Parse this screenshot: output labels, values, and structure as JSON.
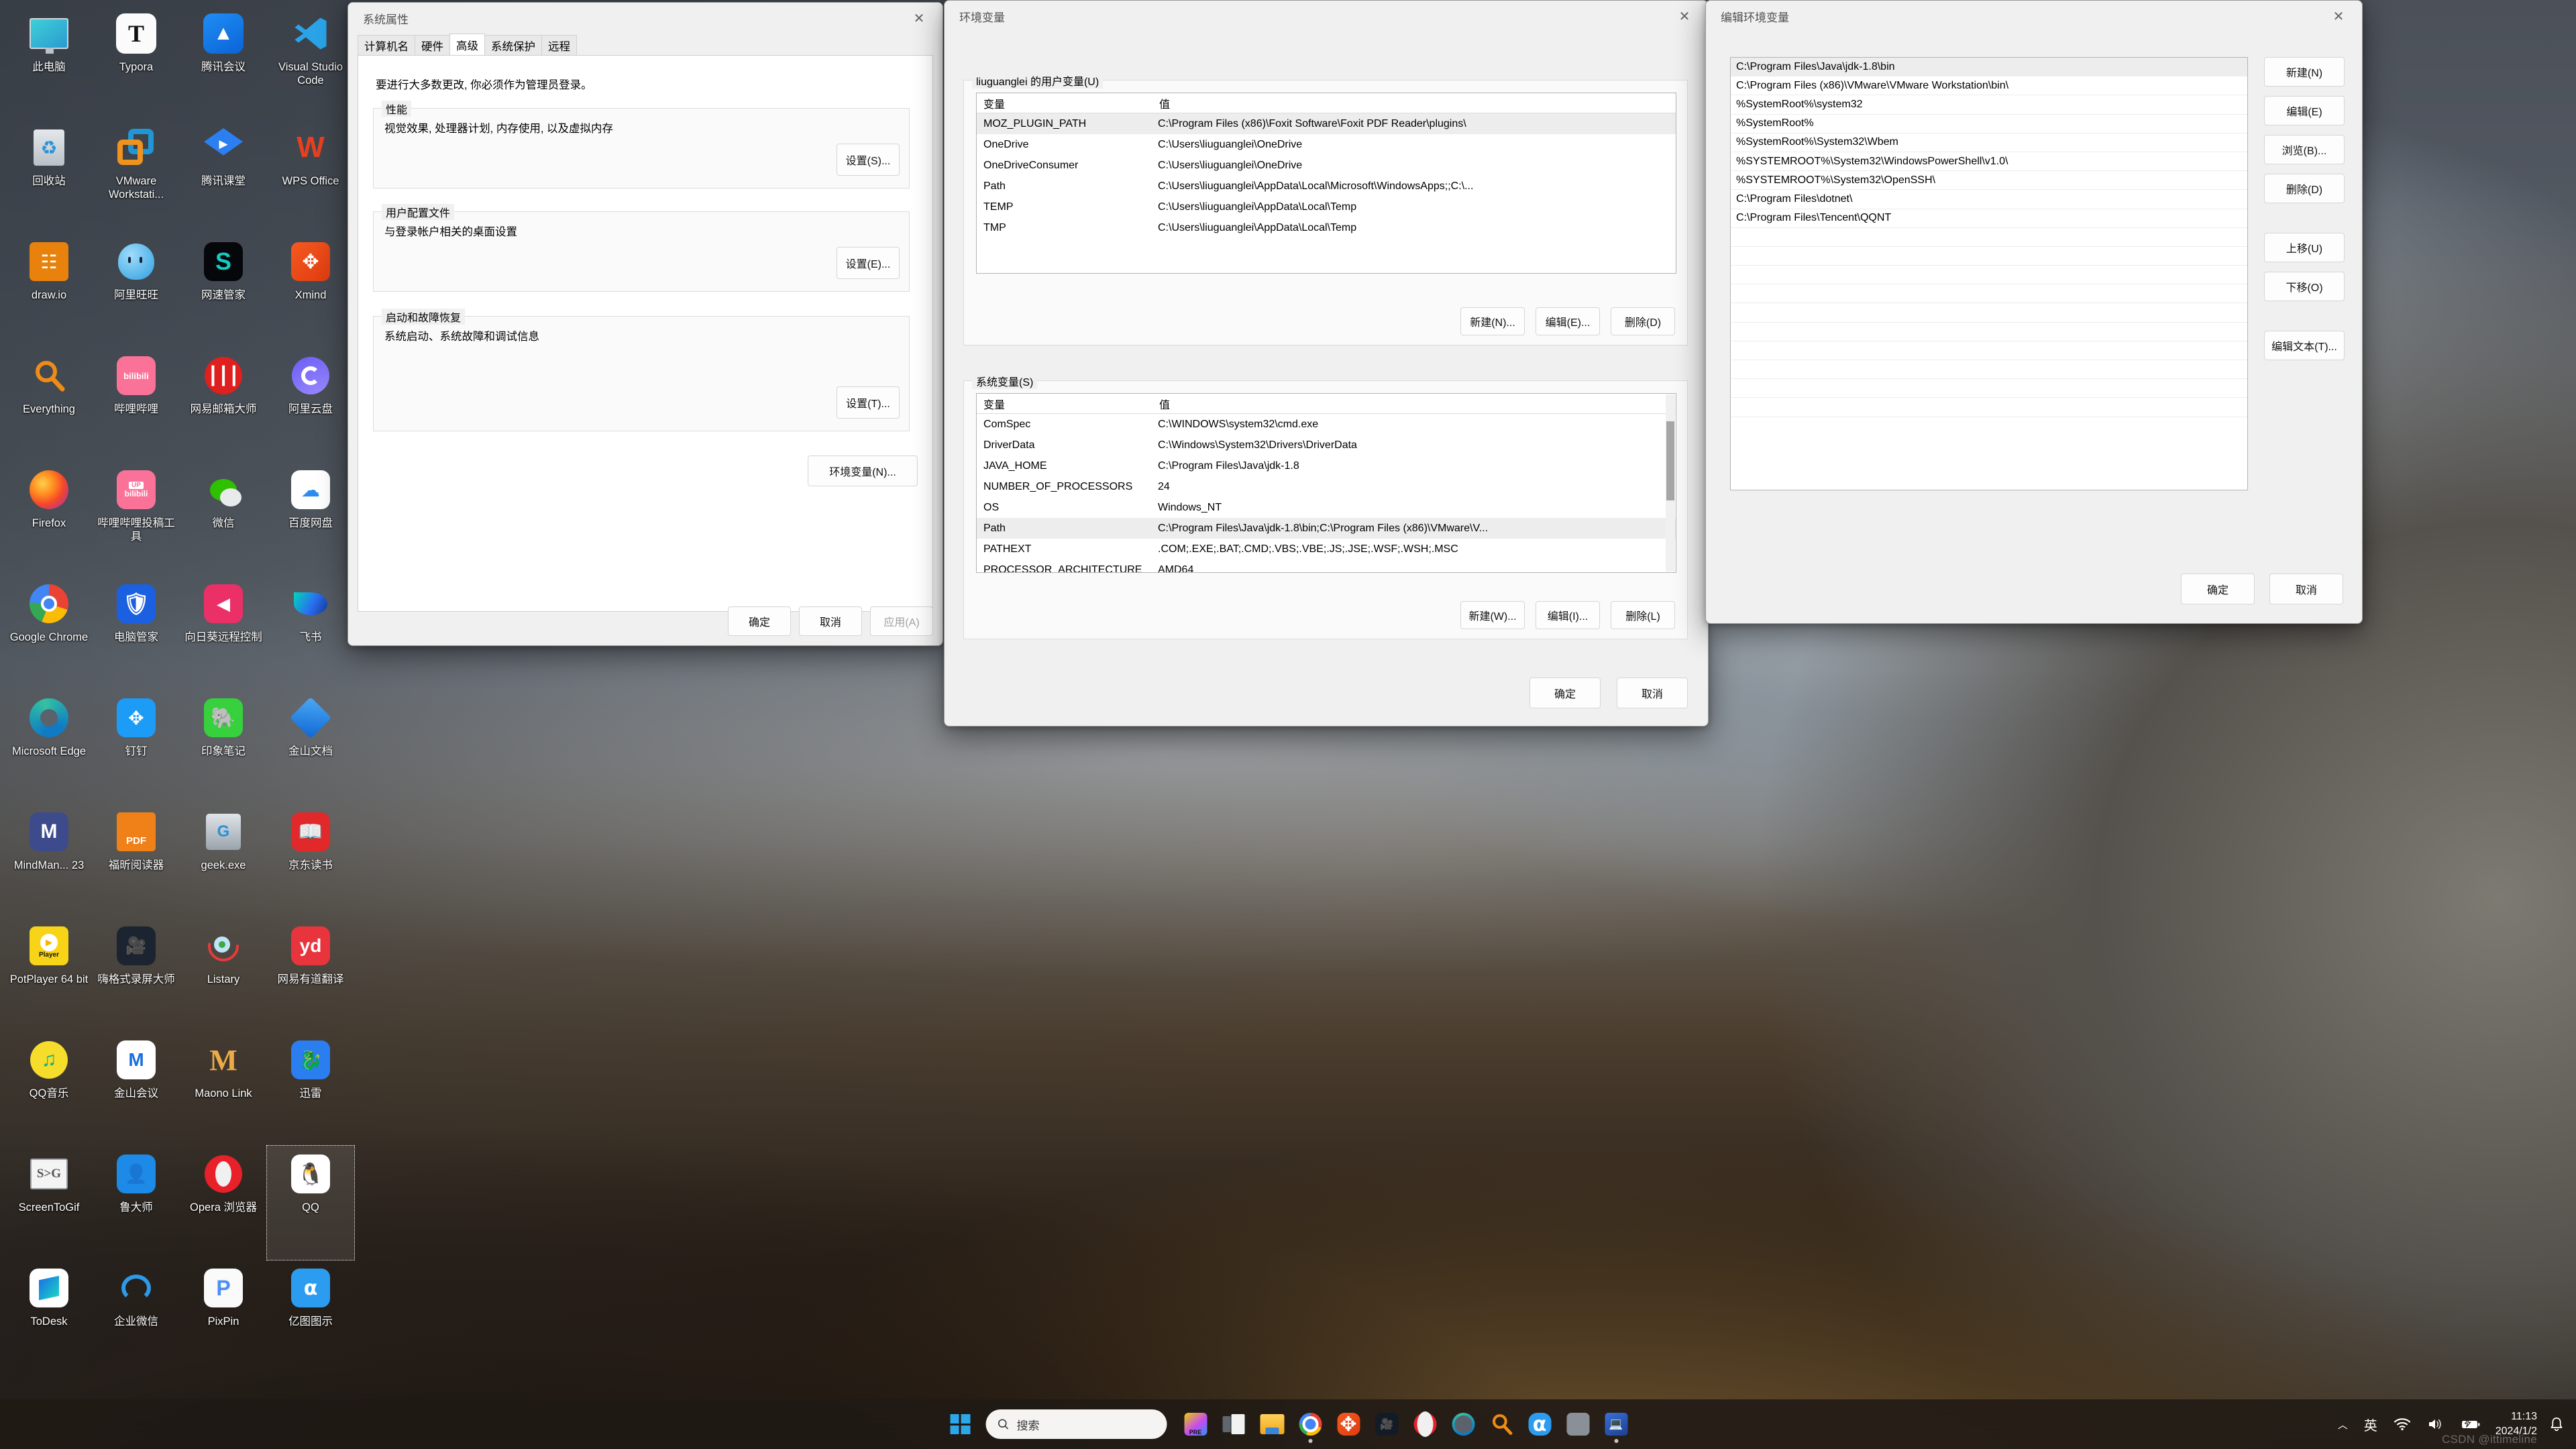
{
  "desktop": {
    "icons": [
      {
        "label": "此电脑",
        "icon": "this-pc-icon"
      },
      {
        "label": "Typora",
        "icon": "typora-icon"
      },
      {
        "label": "腾讯会议",
        "icon": "tencent-meeting-icon"
      },
      {
        "label": "Visual Studio Code",
        "icon": "vscode-icon"
      },
      {
        "label": "回收站",
        "icon": "recycle-bin-icon"
      },
      {
        "label": "VMware Workstati...",
        "icon": "vmware-workstation-icon"
      },
      {
        "label": "腾讯课堂",
        "icon": "tencent-ketang-icon"
      },
      {
        "label": "WPS Office",
        "icon": "wps-office-icon"
      },
      {
        "label": "draw.io",
        "icon": "drawio-icon"
      },
      {
        "label": "阿里旺旺",
        "icon": "aliwangwang-icon"
      },
      {
        "label": "网速管家",
        "icon": "wangsu-guanjia-icon"
      },
      {
        "label": "Xmind",
        "icon": "xmind-icon"
      },
      {
        "label": "Everything",
        "icon": "everything-icon"
      },
      {
        "label": "哔哩哔哩",
        "icon": "bilibili-icon"
      },
      {
        "label": "网易邮箱大师",
        "icon": "netease-mail-icon"
      },
      {
        "label": "阿里云盘",
        "icon": "aliyun-drive-icon"
      },
      {
        "label": "Firefox",
        "icon": "firefox-icon"
      },
      {
        "label": "哔哩哔哩投稿工具",
        "icon": "bilibili-upload-icon"
      },
      {
        "label": "微信",
        "icon": "wechat-icon"
      },
      {
        "label": "百度网盘",
        "icon": "baidu-netdisk-icon"
      },
      {
        "label": "Google Chrome",
        "icon": "chrome-icon"
      },
      {
        "label": "电脑管家",
        "icon": "tencent-pcmgr-icon"
      },
      {
        "label": "向日葵远程控制",
        "icon": "sunlogin-icon"
      },
      {
        "label": "飞书",
        "icon": "feishu-icon"
      },
      {
        "label": "Microsoft Edge",
        "icon": "edge-icon"
      },
      {
        "label": "钉钉",
        "icon": "dingtalk-icon"
      },
      {
        "label": "印象笔记",
        "icon": "evernote-icon"
      },
      {
        "label": "金山文档",
        "icon": "kingsoft-docs-icon"
      },
      {
        "label": "MindMan... 23",
        "icon": "mindmanager-icon"
      },
      {
        "label": "福昕阅读器",
        "icon": "foxit-reader-icon"
      },
      {
        "label": "geek.exe",
        "icon": "geek-uninstaller-icon"
      },
      {
        "label": "京东读书",
        "icon": "jd-read-icon"
      },
      {
        "label": "PotPlayer 64 bit",
        "icon": "potplayer-icon"
      },
      {
        "label": "嗨格式录屏大师",
        "icon": "higeshi-recorder-icon"
      },
      {
        "label": "Listary",
        "icon": "listary-icon"
      },
      {
        "label": "网易有道翻译",
        "icon": "youdao-translate-icon"
      },
      {
        "label": "QQ音乐",
        "icon": "qq-music-icon"
      },
      {
        "label": "金山会议",
        "icon": "kingsoft-meeting-icon"
      },
      {
        "label": "Maono Link",
        "icon": "maono-link-icon"
      },
      {
        "label": "迅雷",
        "icon": "thunder-icon"
      },
      {
        "label": "ScreenToGif",
        "icon": "screentogif-icon"
      },
      {
        "label": "鲁大师",
        "icon": "ludashi-icon"
      },
      {
        "label": "Opera 浏览器",
        "icon": "opera-icon"
      },
      {
        "label": "QQ",
        "icon": "qq-icon",
        "selected": true
      },
      {
        "label": "ToDesk",
        "icon": "todesk-icon"
      },
      {
        "label": "企业微信",
        "icon": "wecom-icon"
      },
      {
        "label": "PixPin",
        "icon": "pixpin-icon"
      },
      {
        "label": "亿图图示",
        "icon": "edraw-icon"
      }
    ]
  },
  "system_properties": {
    "title": "系统属性",
    "close_label": "✕",
    "tabs": [
      {
        "label": "计算机名",
        "active": false
      },
      {
        "label": "硬件",
        "active": false
      },
      {
        "label": "高级",
        "active": true
      },
      {
        "label": "系统保护",
        "active": false
      },
      {
        "label": "远程",
        "active": false
      }
    ],
    "admin_notice": "要进行大多数更改, 你必须作为管理员登录。",
    "groups": [
      {
        "legend": "性能",
        "text": "视觉效果, 处理器计划, 内存使用, 以及虚拟内存",
        "button": "设置(S)..."
      },
      {
        "legend": "用户配置文件",
        "text": "与登录帐户相关的桌面设置",
        "button": "设置(E)..."
      },
      {
        "legend": "启动和故障恢复",
        "text": "系统启动、系统故障和调试信息",
        "button": "设置(T)..."
      }
    ],
    "env_button": "环境变量(N)...",
    "ok_label": "确定",
    "cancel_label": "取消",
    "apply_label": "应用(A)"
  },
  "environment_variables": {
    "title": "环境变量",
    "close_label": "✕",
    "user_section": {
      "legend": "liuguanglei 的用户变量(U)",
      "columns": [
        "变量",
        "值"
      ],
      "rows": [
        {
          "name": "MOZ_PLUGIN_PATH",
          "value": "C:\\Program Files (x86)\\Foxit Software\\Foxit PDF Reader\\plugins\\",
          "selected": true
        },
        {
          "name": "OneDrive",
          "value": "C:\\Users\\liuguanglei\\OneDrive"
        },
        {
          "name": "OneDriveConsumer",
          "value": "C:\\Users\\liuguanglei\\OneDrive"
        },
        {
          "name": "Path",
          "value": "C:\\Users\\liuguanglei\\AppData\\Local\\Microsoft\\WindowsApps;;C:\\..."
        },
        {
          "name": "TEMP",
          "value": "C:\\Users\\liuguanglei\\AppData\\Local\\Temp"
        },
        {
          "name": "TMP",
          "value": "C:\\Users\\liuguanglei\\AppData\\Local\\Temp"
        }
      ],
      "new_label": "新建(N)...",
      "edit_label": "编辑(E)...",
      "delete_label": "删除(D)"
    },
    "system_section": {
      "legend": "系统变量(S)",
      "columns": [
        "变量",
        "值"
      ],
      "rows": [
        {
          "name": "ComSpec",
          "value": "C:\\WINDOWS\\system32\\cmd.exe"
        },
        {
          "name": "DriverData",
          "value": "C:\\Windows\\System32\\Drivers\\DriverData"
        },
        {
          "name": "JAVA_HOME",
          "value": "C:\\Program Files\\Java\\jdk-1.8"
        },
        {
          "name": "NUMBER_OF_PROCESSORS",
          "value": "24"
        },
        {
          "name": "OS",
          "value": "Windows_NT"
        },
        {
          "name": "Path",
          "value": "C:\\Program Files\\Java\\jdk-1.8\\bin;C:\\Program Files (x86)\\VMware\\V...",
          "selected": true
        },
        {
          "name": "PATHEXT",
          "value": ".COM;.EXE;.BAT;.CMD;.VBS;.VBE;.JS;.JSE;.WSF;.WSH;.MSC"
        },
        {
          "name": "PROCESSOR_ARCHITECTURE",
          "value": "AMD64"
        }
      ],
      "new_label": "新建(W)...",
      "edit_label": "编辑(I)...",
      "delete_label": "删除(L)"
    },
    "ok_label": "确定",
    "cancel_label": "取消"
  },
  "edit_environment_variable": {
    "title": "编辑环境变量",
    "close_label": "✕",
    "entries": [
      {
        "value": "C:\\Program Files\\Java\\jdk-1.8\\bin",
        "selected": true
      },
      {
        "value": "C:\\Program Files (x86)\\VMware\\VMware Workstation\\bin\\"
      },
      {
        "value": "%SystemRoot%\\system32"
      },
      {
        "value": "%SystemRoot%"
      },
      {
        "value": "%SystemRoot%\\System32\\Wbem"
      },
      {
        "value": "%SYSTEMROOT%\\System32\\WindowsPowerShell\\v1.0\\"
      },
      {
        "value": "%SYSTEMROOT%\\System32\\OpenSSH\\"
      },
      {
        "value": "C:\\Program Files\\dotnet\\"
      },
      {
        "value": "C:\\Program Files\\Tencent\\QQNT"
      },
      {
        "value": ""
      },
      {
        "value": ""
      },
      {
        "value": ""
      },
      {
        "value": ""
      },
      {
        "value": ""
      },
      {
        "value": ""
      },
      {
        "value": ""
      },
      {
        "value": ""
      },
      {
        "value": ""
      },
      {
        "value": ""
      }
    ],
    "buttons": [
      {
        "label": "新建(N)",
        "name": "new-button"
      },
      {
        "label": "编辑(E)",
        "name": "edit-button"
      },
      {
        "label": "浏览(B)...",
        "name": "browse-button"
      },
      {
        "label": "删除(D)",
        "name": "delete-button"
      },
      {
        "label": "上移(U)",
        "name": "move-up-button"
      },
      {
        "label": "下移(O)",
        "name": "move-down-button"
      },
      {
        "label": "编辑文本(T)...",
        "name": "edit-text-button"
      }
    ],
    "ok_label": "确定",
    "cancel_label": "取消"
  },
  "taskbar": {
    "start_label": "开始",
    "search": {
      "placeholder": "搜索",
      "icon": "search-icon"
    },
    "items": [
      {
        "name": "taskbar-premiere",
        "icon": "premiere-icon",
        "running": false
      },
      {
        "name": "taskbar-task-view",
        "icon": "task-view-icon",
        "running": false
      },
      {
        "name": "taskbar-file-explorer",
        "icon": "file-explorer-icon",
        "running": false
      },
      {
        "name": "taskbar-chrome",
        "icon": "chrome-icon",
        "running": true
      },
      {
        "name": "taskbar-xmind",
        "icon": "xmind-icon",
        "running": false
      },
      {
        "name": "taskbar-recorder",
        "icon": "recorder-icon",
        "running": false
      },
      {
        "name": "taskbar-opera",
        "icon": "opera-icon",
        "running": false
      },
      {
        "name": "taskbar-edge",
        "icon": "edge-icon",
        "running": false
      },
      {
        "name": "taskbar-everything",
        "icon": "everything-icon",
        "running": false
      },
      {
        "name": "taskbar-edraw",
        "icon": "edraw-icon",
        "running": false
      },
      {
        "name": "taskbar-youdao",
        "icon": "youdao-icon",
        "running": false
      },
      {
        "name": "taskbar-system-properties",
        "icon": "system-properties-icon",
        "running": true
      }
    ],
    "tray": {
      "chevron": "︿",
      "ime": "英",
      "wifi_icon": "wifi-icon",
      "volume_icon": "volume-icon",
      "battery_icon": "battery-charging-icon",
      "time": "11:13",
      "date": "2024/1/2",
      "notification_icon": "bell-icon"
    },
    "watermark": "CSDN @ittimeline"
  },
  "colors": {
    "accent": "#2ca7e8",
    "window_bg": "#f0f0f0",
    "selection": "#ededed"
  }
}
